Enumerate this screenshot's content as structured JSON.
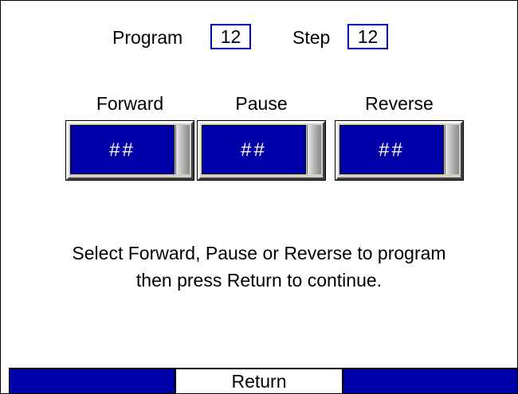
{
  "header": {
    "program_label": "Program",
    "program_value": "12",
    "step_label": "Step",
    "step_value": "12"
  },
  "modes": [
    {
      "label": "Forward",
      "value": "##"
    },
    {
      "label": "Pause",
      "value": "##"
    },
    {
      "label": "Reverse",
      "value": "##"
    }
  ],
  "instructions": {
    "line1": "Select Forward, Pause or Reverse to program",
    "line2": "then press Return to continue."
  },
  "footer": {
    "left_label": "",
    "return_label": "Return",
    "right_label": ""
  },
  "colors": {
    "accent": "#0000a8",
    "box_border": "#0000c0",
    "background": "#ffffff"
  }
}
